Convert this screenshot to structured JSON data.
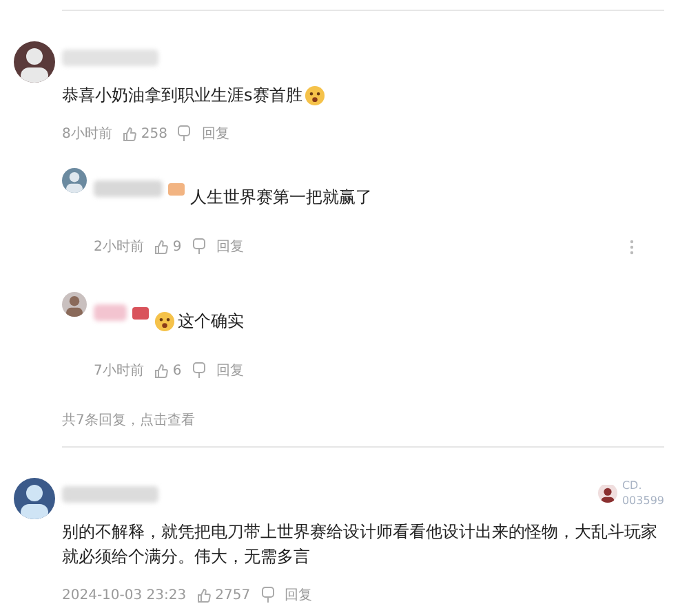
{
  "comments": [
    {
      "text": "恭喜小奶油拿到职业生涯s赛首胜",
      "emoji_before": false,
      "emoji_after": true,
      "time": "8小时前",
      "likes": "258",
      "reply": "回复",
      "replies": [
        {
          "text": "人生世界赛第一把就赢了",
          "emoji_before": false,
          "emoji_after": false,
          "color": "#f2b482",
          "time": "2小时前",
          "likes": "9",
          "reply": "回复",
          "menu": true
        },
        {
          "text": "这个确实",
          "emoji_before": true,
          "emoji_after": false,
          "color": "#d9535b",
          "time": "7小时前",
          "likes": "6",
          "reply": "回复",
          "menu": false
        }
      ],
      "more_replies": "共7条回复，点击查看"
    },
    {
      "text": "别的不解释，就凭把电刀带上世界赛给设计师看看他设计出来的怪物，大乱斗玩家就必须给个满分。伟大，无需多言",
      "emoji_before": false,
      "emoji_after": false,
      "time": "2024-10-03 23:23",
      "likes": "2757",
      "reply": "回复",
      "side_label": [
        "CD.",
        "003599"
      ]
    }
  ]
}
